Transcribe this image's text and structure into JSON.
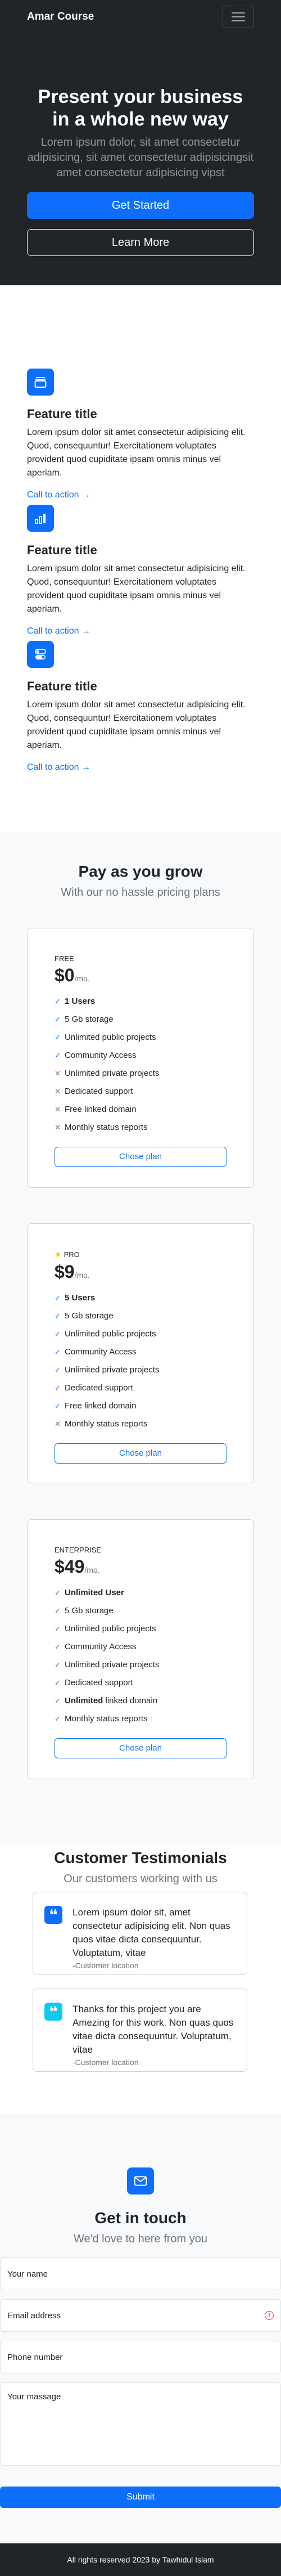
{
  "nav": {
    "brand": "Amar Course"
  },
  "hero": {
    "title": "Present your business in a whole new way",
    "lead": "Lorem ipsum dolor, sit amet consectetur adipisicing, sit amet consectetur adipisicingsit amet consectetur adipisicing vipst",
    "primary_button": "Get Started",
    "secondary_button": "Learn More"
  },
  "features": [
    {
      "title": "Feature title",
      "text": "Lorem ipsum dolor sit amet consectetur adipisicing elit. Quod, consequuntur! Exercitationem voluptates provident quod cupiditate ipsam omnis minus vel aperiam.",
      "cta": "Call to action →",
      "icon": "collection-icon"
    },
    {
      "title": "Feature title",
      "text": "Lorem ipsum dolor sit amet consectetur adipisicing elit. Quod, consequuntur! Exercitationem voluptates provident quod cupiditate ipsam omnis minus vel aperiam.",
      "cta": "Call to action →",
      "icon": "bar-chart-icon"
    },
    {
      "title": "Feature title",
      "text": "Lorem ipsum dolor sit amet consectetur adipisicing elit. Quod, consequuntur! Exercitationem voluptates provident quod cupiditate ipsam omnis minus vel aperiam.",
      "cta": "Call to action →",
      "icon": "toggles-icon"
    }
  ],
  "pricing": {
    "title": "Pay as you grow",
    "subtitle": "With our no hassle pricing plans",
    "plans": [
      {
        "tier": "Free",
        "price": "$0",
        "period": "/mo.",
        "button": "Chose plan",
        "items": [
          {
            "label": "1 Users",
            "bold": true,
            "on": true
          },
          {
            "label": "5 Gb storage",
            "on": true
          },
          {
            "label": "Unlimited public projects",
            "on": true
          },
          {
            "label": "Community Access",
            "on": true
          },
          {
            "label": "Unlimited private projects",
            "on": false
          },
          {
            "label": "Dedicated support",
            "on": false
          },
          {
            "label": "Free linked domain",
            "on": false
          },
          {
            "label": "Monthly status reports",
            "on": false
          }
        ]
      },
      {
        "tier": "Pro",
        "price": "$9",
        "period": "/mo.",
        "button": "Chose plan",
        "items": [
          {
            "label": "5 Users",
            "bold": true,
            "on": true
          },
          {
            "label": "5 Gb storage",
            "on": true
          },
          {
            "label": "Unlimited public projects",
            "on": true
          },
          {
            "label": "Community Access",
            "on": true
          },
          {
            "label": "Unlimited private projects",
            "on": true
          },
          {
            "label": "Dedicated support",
            "on": true
          },
          {
            "label": "Free linked domain",
            "on": true
          },
          {
            "label": "Monthly status reports",
            "on": false
          }
        ]
      },
      {
        "tier": "Enterprise",
        "price": "$49",
        "period": "/mo.",
        "button": "Chose plan",
        "items": [
          {
            "label": "Unlimited User",
            "bold": true,
            "on": true
          },
          {
            "label": "5 Gb storage",
            "on": true
          },
          {
            "label": "Unlimited public projects",
            "on": true
          },
          {
            "label": "Community Access",
            "on": true
          },
          {
            "label": "Unlimited private projects",
            "on": true
          },
          {
            "label": "Dedicated support",
            "on": true
          },
          {
            "label_bold": "Unlimited",
            "label": " linked domain",
            "on": true
          },
          {
            "label": "Monthly status reports",
            "on": true
          }
        ]
      }
    ]
  },
  "testimonials": {
    "title": "Customer Testimonials",
    "subtitle": "Our customers working with us",
    "items": [
      {
        "quote": "Lorem ipsum dolor sit, amet consectetur adipisicing elit. Non quas quos vitae dicta consequuntur. Voluptatum, vitae",
        "location": "-Customer location",
        "color": "#0d6efd"
      },
      {
        "quote": "Thanks for this project you are Amezing for this work. Non quas quos vitae dicta consequuntur. Voluptatum, vitae",
        "location": "-Customer location",
        "color": "#0dcaf0"
      }
    ]
  },
  "contact": {
    "title": "Get in touch",
    "subtitle": "We'd love to here from you",
    "name_placeholder": "Your name",
    "email_placeholder": "Email address",
    "phone_placeholder": "Phone number",
    "message_placeholder": "Your massage",
    "submit": "Submit"
  },
  "footer": {
    "text": "All rights reserved 2023 by Tawhidul Islam"
  },
  "colors": {
    "accent": "#0d6efd",
    "dark": "#212529",
    "light": "#f8f9fa",
    "star": "#ffc107",
    "danger": "#dc3545"
  }
}
